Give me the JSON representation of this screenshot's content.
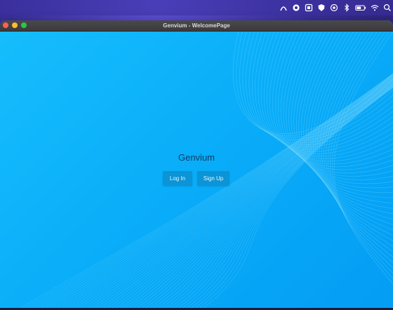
{
  "window": {
    "title": "Genvium - WelcomePage"
  },
  "app": {
    "name": "Genvium"
  },
  "buttons": {
    "login": "Log In",
    "signup": "Sign Up"
  },
  "menubar": {
    "icons": [
      "app-icon",
      "chat-icon",
      "bag-icon",
      "shield-icon",
      "record-icon",
      "bluetooth-icon",
      "battery-icon",
      "wifi-icon",
      "search-icon"
    ]
  },
  "colors": {
    "background": "#0aa6f5",
    "button": "#0b94d6",
    "app_name": "#0f3b63",
    "titlebar": "#3b3b3d"
  }
}
